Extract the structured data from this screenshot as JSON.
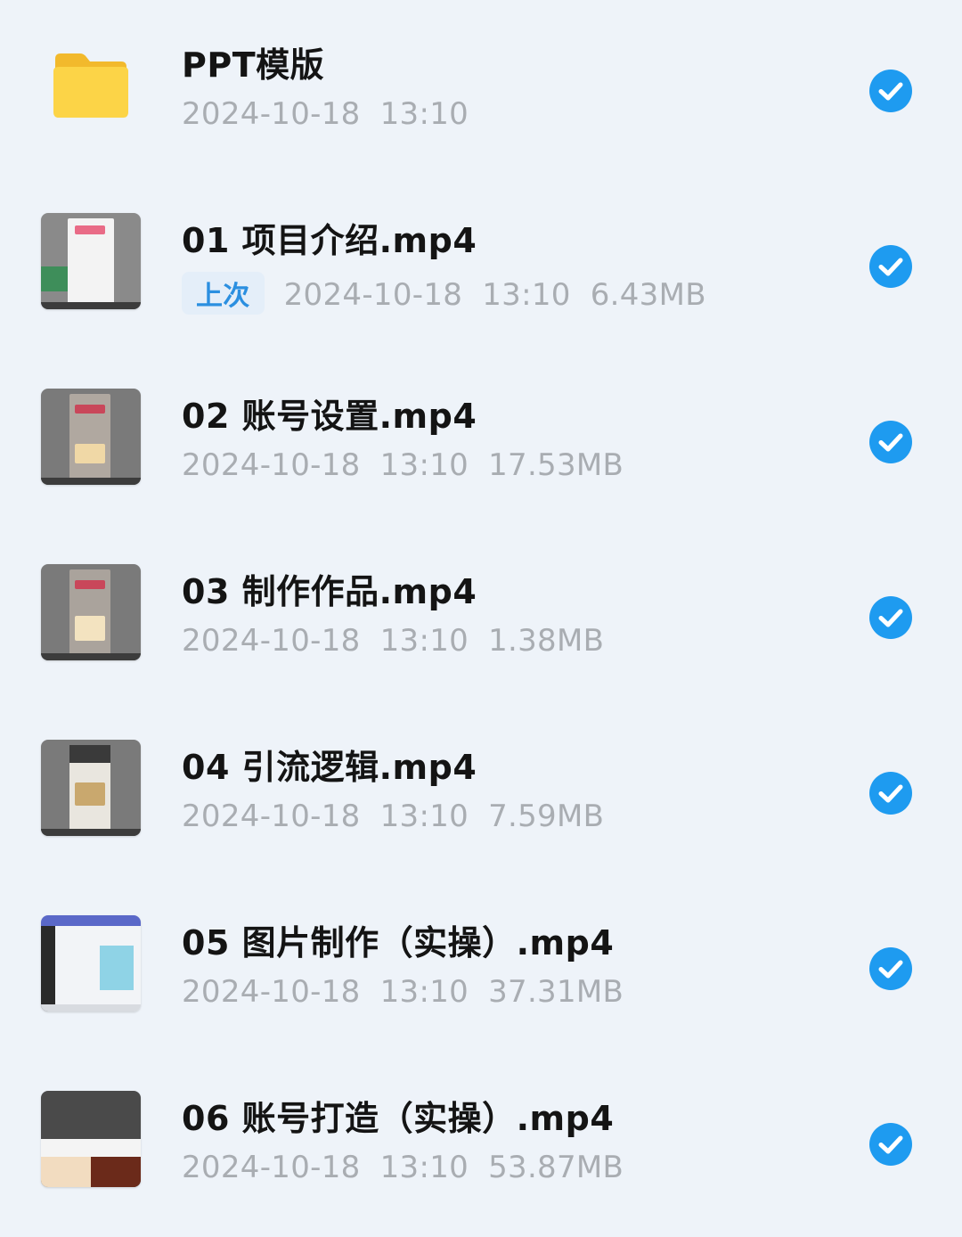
{
  "files": [
    {
      "name": "PPT模版",
      "type": "folder",
      "date": "2024-10-18",
      "time": "13:10",
      "size": "",
      "badge": "",
      "checked": true,
      "thumb_icon": "folder-icon"
    },
    {
      "name": "01 项目介绍.mp4",
      "type": "video",
      "date": "2024-10-18",
      "time": "13:10",
      "size": "6.43MB",
      "badge": "上次",
      "checked": true,
      "thumb_icon": "video-thumbnail"
    },
    {
      "name": "02 账号设置.mp4",
      "type": "video",
      "date": "2024-10-18",
      "time": "13:10",
      "size": "17.53MB",
      "badge": "",
      "checked": true,
      "thumb_icon": "video-thumbnail"
    },
    {
      "name": "03 制作作品.mp4",
      "type": "video",
      "date": "2024-10-18",
      "time": "13:10",
      "size": "1.38MB",
      "badge": "",
      "checked": true,
      "thumb_icon": "video-thumbnail"
    },
    {
      "name": "04 引流逻辑.mp4",
      "type": "video",
      "date": "2024-10-18",
      "time": "13:10",
      "size": "7.59MB",
      "badge": "",
      "checked": true,
      "thumb_icon": "video-thumbnail"
    },
    {
      "name": "05 图片制作（实操）.mp4",
      "type": "video",
      "date": "2024-10-18",
      "time": "13:10",
      "size": "37.31MB",
      "badge": "",
      "checked": true,
      "thumb_icon": "video-thumbnail"
    },
    {
      "name": "06 账号打造（实操）.mp4",
      "type": "video",
      "date": "2024-10-18",
      "time": "13:10",
      "size": "53.87MB",
      "badge": "",
      "checked": true,
      "thumb_icon": "video-thumbnail"
    }
  ],
  "colors": {
    "background": "#eef3f9",
    "check": "#1e9bf0",
    "badge_text": "#2b8fe0",
    "badge_bg": "#e4eef9",
    "meta_text": "#a9adb2",
    "folder": "#f7c637"
  }
}
